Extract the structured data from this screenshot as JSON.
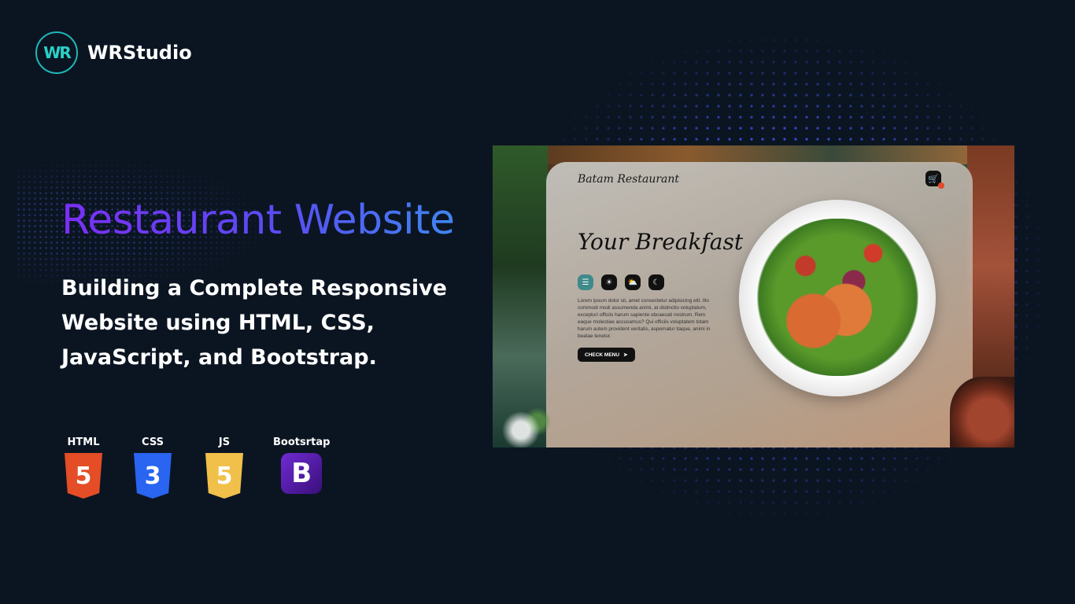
{
  "brand": {
    "logo_mark": "WR",
    "name": "WRStudio"
  },
  "headline": "Restaurant Website",
  "subtitle": "Building a Complete Responsive Website using HTML, CSS, JavaScript, and Bootstrap.",
  "tech": [
    {
      "label": "HTML",
      "glyph": "5",
      "color": "#e44d26"
    },
    {
      "label": "CSS",
      "glyph": "3",
      "color": "#2965f1"
    },
    {
      "label": "JS",
      "glyph": "5",
      "color": "#f0c04a"
    },
    {
      "label": "Bootsrtap",
      "glyph": "B",
      "color": "#6f2bd3"
    }
  ],
  "mockup": {
    "brand": "Batam Restaurant",
    "title": "Your Breakfast",
    "icons": [
      "menu-icon",
      "sun-icon",
      "afternoon-icon",
      "moon-icon"
    ],
    "body": "Lorem ipsum dolor sit, amet consectetur adipisicing elit. Illo commodi modi assumenda animi, at distinctio voluptatum, excepturi officiis harum sapiente obcaecati nostrum. Rem eaque molestiae accusamus? Qui officiis voluptatem totam harum autem provident veritatis, aspernatur itaque, animi in beatae tenetur.",
    "cta": "CHECK MENU"
  }
}
